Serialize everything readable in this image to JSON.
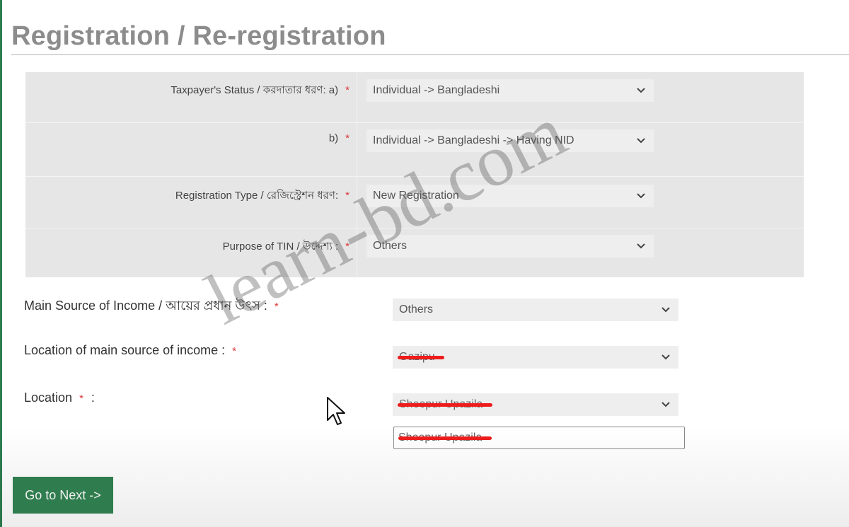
{
  "page": {
    "title": "Registration / Re-registration"
  },
  "rows": [
    {
      "label": "Taxpayer's Status / করদাতার ধরণ: a)",
      "required": "*",
      "value": "Individual -> Bangladeshi"
    },
    {
      "label": "b)",
      "required": "*",
      "value": "Individual -> Bangladeshi -> Having NID"
    },
    {
      "label": "Registration Type / রেজিস্ট্রেশন ধরণ:",
      "required": "*",
      "value": "New Registration"
    },
    {
      "label": "Purpose of TIN / উদ্দেশ্য :",
      "required": "*",
      "value": "Others"
    }
  ],
  "form": {
    "main_source": {
      "label": "Main Source of Income / আয়ের প্রধান উৎস :",
      "required": "*",
      "value": "Others"
    },
    "location_main": {
      "label": "Location of main source of income :",
      "required": "*",
      "value": "Gazipu"
    },
    "location": {
      "label": "Location",
      "required": "*",
      "colon": ":",
      "value": "Sheepur Upazila"
    },
    "location_text": {
      "value": "Sheepur Upazila"
    }
  },
  "buttons": {
    "next": "Go to Next ->"
  },
  "watermark": {
    "text": "learn-bd.com"
  },
  "colors": {
    "accent": "#2f7d4e",
    "required": "#d9383a",
    "redaction": "#ee1c1c"
  }
}
